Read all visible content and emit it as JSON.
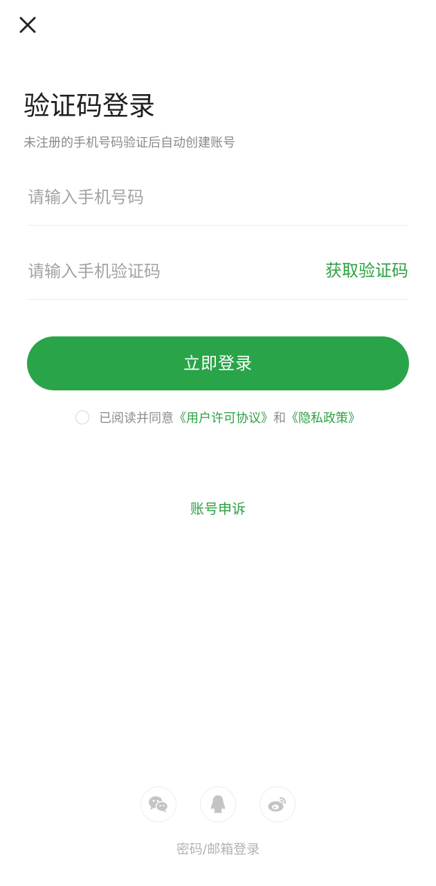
{
  "header": {
    "close_icon": "close-icon"
  },
  "main": {
    "title": "验证码登录",
    "subtitle": "未注册的手机号码验证后自动创建账号",
    "phone_input": {
      "value": "",
      "placeholder": "请输入手机号码"
    },
    "code_input": {
      "value": "",
      "placeholder": "请输入手机验证码"
    },
    "get_code_label": "获取验证码",
    "login_button_label": "立即登录",
    "agreement": {
      "prefix": "已阅读并同意",
      "user_agreement": "《用户许可协议》",
      "conjunction": "和",
      "privacy_policy": "《隐私政策》"
    },
    "appeal_link": "账号申诉"
  },
  "footer": {
    "social_icons": [
      "wechat-icon",
      "qq-icon",
      "weibo-icon"
    ],
    "other_login_label": "密码/邮箱登录"
  },
  "colors": {
    "accent": "#2aa449",
    "link": "#2ea043",
    "placeholder": "#a3a3a3",
    "icon_gray": "#c4c4c4"
  }
}
